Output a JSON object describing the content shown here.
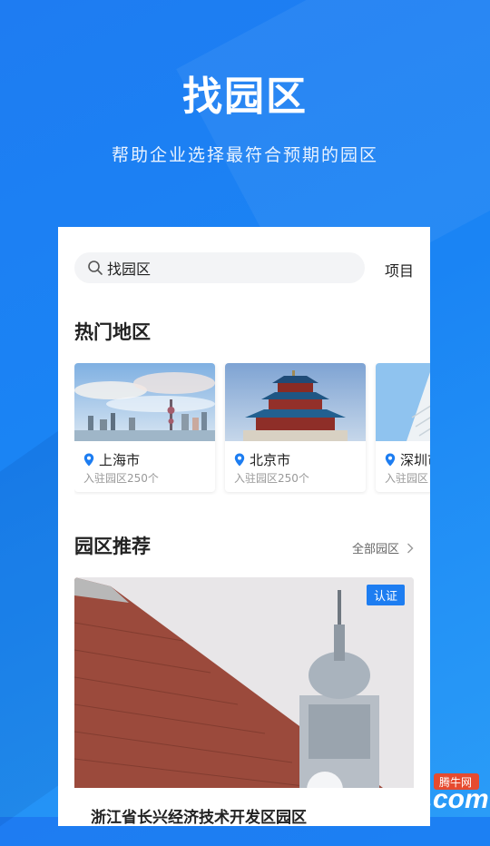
{
  "header": {
    "title": "找园区",
    "subtitle": "帮助企业选择最符合预期的园区"
  },
  "search": {
    "value": "找园区",
    "icon": "search-icon"
  },
  "project_tab": "项目",
  "hot_regions": {
    "title": "热门地区",
    "items": [
      {
        "name": "上海市",
        "meta": "入驻园区250个"
      },
      {
        "name": "北京市",
        "meta": "入驻园区250个"
      },
      {
        "name": "深圳市",
        "meta": "入驻园区"
      }
    ]
  },
  "recommend": {
    "title": "园区推荐",
    "all_link": "全部园区",
    "park": {
      "badge": "认证",
      "name": "浙江省长兴经济技术开发区园区"
    }
  },
  "watermark": {
    "text": "QQTN.com",
    "tag": "腾牛网"
  },
  "colors": {
    "brand": "#1d7df1",
    "text": "#222222",
    "muted": "#999999"
  }
}
